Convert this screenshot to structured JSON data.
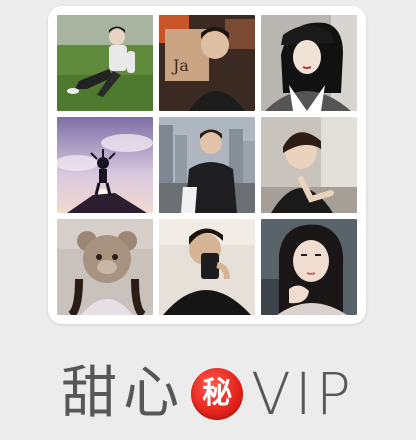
{
  "app": {
    "name_part1": "甜心",
    "badge_glyph": "秘",
    "name_part2": "VIP"
  },
  "icon": {
    "photos": [
      "photo-man-sitting-on-grass",
      "photo-man-with-magazine",
      "photo-woman-black-cap",
      "photo-silhouette-on-rock",
      "photo-man-city-street",
      "photo-man-sitting-indoors",
      "photo-person-teddy-bear-hat",
      "photo-man-phone-selfie",
      "photo-woman-hand-on-chin"
    ]
  },
  "colors": {
    "background": "#ececec",
    "title_text": "#575757",
    "badge_red": "#e3221a"
  }
}
